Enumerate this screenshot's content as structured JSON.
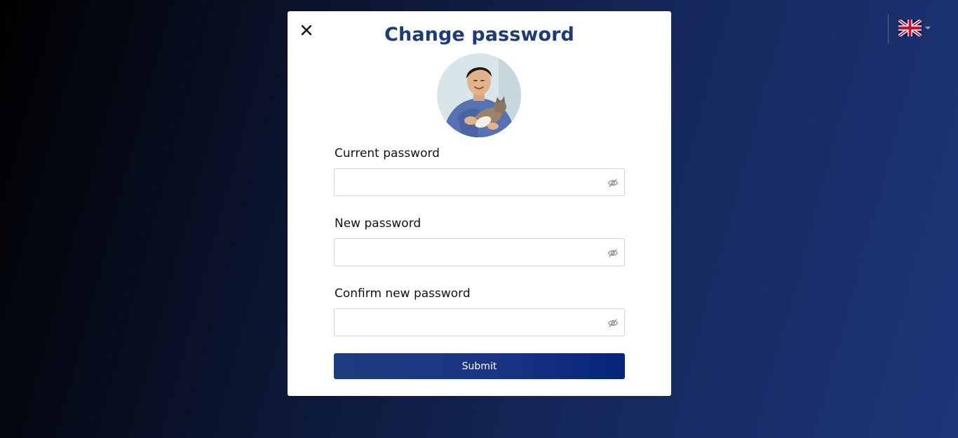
{
  "language": {
    "flag_icon": "uk-flag-icon",
    "caret_icon": "caret-down-icon"
  },
  "modal": {
    "title": "Change password",
    "close_icon": "close-icon",
    "avatar_icon": "user-avatar",
    "fields": [
      {
        "label": "Current password",
        "value": "",
        "toggle_icon": "eye-slash-icon"
      },
      {
        "label": "New password",
        "value": "",
        "toggle_icon": "eye-slash-icon"
      },
      {
        "label": "Confirm new password",
        "value": "",
        "toggle_icon": "eye-slash-icon"
      }
    ],
    "submit_label": "Submit"
  },
  "colors": {
    "title": "#1d3a7a",
    "button": "#1a3584",
    "background_start": "#000000",
    "background_end": "#1c3679"
  }
}
